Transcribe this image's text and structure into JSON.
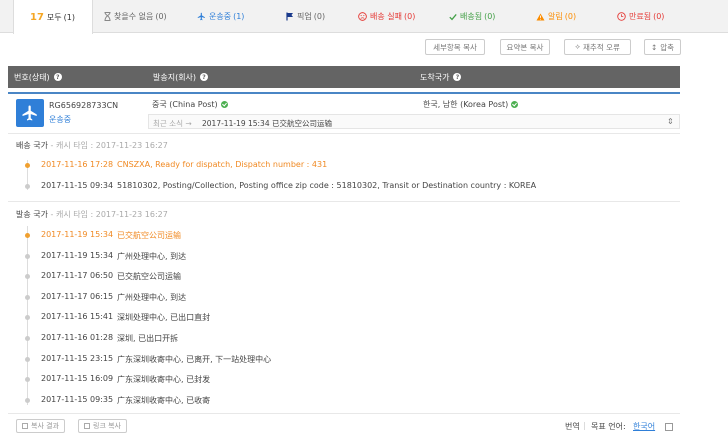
{
  "tabs": [
    {
      "label": "모두",
      "count": "(1)",
      "icon": "logo-17-icon",
      "color": "#f5a623"
    },
    {
      "label": "찾을수 없음",
      "count": "(0)",
      "icon": "hourglass-icon",
      "color": "#888888"
    },
    {
      "label": "운송중",
      "count": "(1)",
      "icon": "plane-icon",
      "color": "#2f7fd8"
    },
    {
      "label": "픽업",
      "count": "(0)",
      "icon": "flag-icon",
      "color": "#1a3a8c"
    },
    {
      "label": "배송 실패",
      "count": "(0)",
      "icon": "sad-face-icon",
      "color": "#e53935"
    },
    {
      "label": "배송됨",
      "count": "(0)",
      "icon": "check-icon",
      "color": "#43a047"
    },
    {
      "label": "알림",
      "count": "(0)",
      "icon": "warning-icon",
      "color": "#fb8c00"
    },
    {
      "label": "만료됨",
      "count": "(0)",
      "icon": "clock-icon",
      "color": "#e53935"
    }
  ],
  "toolbar": {
    "copy_detail": "세부항목 복사",
    "copy_summary": "요약본 복사",
    "retrack": "재추적 오류",
    "compress": "압축"
  },
  "table_header": {
    "number_status": "번호(상태)",
    "origin": "발송지(회사)",
    "destination": "도착국가"
  },
  "shipment": {
    "tracking_number": "RG656928733CN",
    "status": "운송중",
    "origin": "중국 (China Post)",
    "destination": "한국, 남한 (Korea Post)",
    "latest_label": "최근 소식 →",
    "latest_event": "2017-11-19 15:34  已交航空公司运输"
  },
  "destination_section": {
    "title": "배송 국가",
    "cache_time": "- 캐시 타임 : 2017-11-23 16:27",
    "events": [
      {
        "date": "2017-11-16 17:28",
        "desc": "CNSZXA, Ready for dispatch, Dispatch number : 431"
      },
      {
        "date": "2017-11-15 09:34",
        "desc": "51810302, Posting/Collection, Posting office zip code : 51810302, Transit or Destination country : KOREA"
      }
    ]
  },
  "origin_section": {
    "title": "발송 국가",
    "cache_time": "- 캐시 타임 : 2017-11-23 16:27",
    "events": [
      {
        "date": "2017-11-19 15:34",
        "desc": "已交航空公司运输"
      },
      {
        "date": "2017-11-19 15:34",
        "desc": "广州处理中心, 到达"
      },
      {
        "date": "2017-11-17 06:50",
        "desc": "已交航空公司运输"
      },
      {
        "date": "2017-11-17 06:15",
        "desc": "广州处理中心, 到达"
      },
      {
        "date": "2017-11-16 15:41",
        "desc": "深圳处理中心, 已出口直封"
      },
      {
        "date": "2017-11-16 01:28",
        "desc": "深圳, 已出口开拆"
      },
      {
        "date": "2017-11-15 23:15",
        "desc": "广东深圳收寄中心, 已离开, 下一站处理中心"
      },
      {
        "date": "2017-11-15 16:09",
        "desc": "广东深圳收寄中心, 已封发"
      },
      {
        "date": "2017-11-15 09:35",
        "desc": "广东深圳收寄中心, 已收寄"
      }
    ]
  },
  "footer": {
    "copy_result": "복사 결과",
    "copy_link": "링크 복사",
    "translate": "번역",
    "target_language_label": "목표 언어:",
    "target_language": "한국어"
  }
}
